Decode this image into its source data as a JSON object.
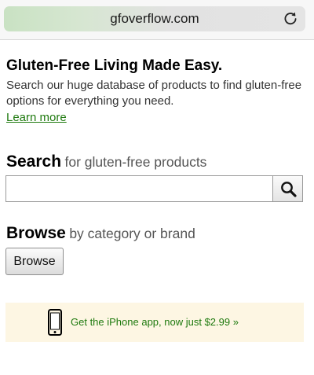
{
  "browser": {
    "url": "gfoverflow.com"
  },
  "hero": {
    "title": "Gluten-Free Living Made Easy.",
    "description": "Search our huge database of products to find gluten-free options for everything you need.",
    "learn_more": "Learn more"
  },
  "search": {
    "heading": "Search",
    "subheading": "for gluten-free products",
    "input_value": ""
  },
  "browse": {
    "heading": "Browse",
    "subheading": "by category or brand",
    "button_label": "Browse"
  },
  "promo": {
    "text": "Get the iPhone app, now just $2.99 »"
  },
  "colors": {
    "link_green": "#1f7a0f",
    "promo_background": "#fdf6e3"
  },
  "icons": {
    "reload": "reload-icon",
    "search": "magnifier-icon",
    "phone": "smartphone-icon"
  }
}
